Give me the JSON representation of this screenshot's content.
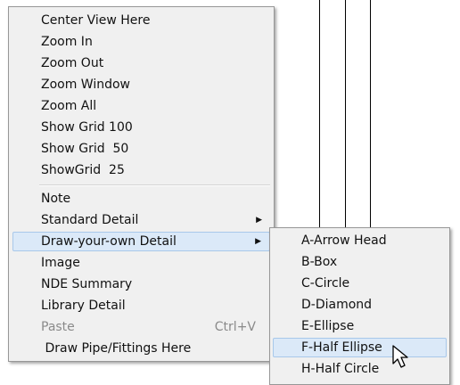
{
  "main_menu": {
    "items": [
      {
        "label": "Center View Here"
      },
      {
        "label": "Zoom In"
      },
      {
        "label": "Zoom Out"
      },
      {
        "label": "Zoom Window"
      },
      {
        "label": "Zoom All"
      },
      {
        "label": "Show Grid 100"
      },
      {
        "label": "Show Grid  50"
      },
      {
        "label": "ShowGrid  25"
      },
      {
        "label": "Note"
      },
      {
        "label": "Standard Detail"
      },
      {
        "label": "Draw-your-own Detail"
      },
      {
        "label": "Image"
      },
      {
        "label": "NDE Summary"
      },
      {
        "label": "Library Detail"
      },
      {
        "label": "Paste",
        "shortcut": "Ctrl+V"
      },
      {
        "label": " Draw Pipe/Fittings Here"
      }
    ]
  },
  "sub_menu": {
    "items": [
      {
        "label": "A-Arrow Head"
      },
      {
        "label": "B-Box"
      },
      {
        "label": "C-Circle"
      },
      {
        "label": "D-Diamond"
      },
      {
        "label": "E-Ellipse"
      },
      {
        "label": "F-Half Ellipse"
      },
      {
        "label": "H-Half Circle"
      }
    ]
  },
  "colors": {
    "menu_bg": "#f0f0f0",
    "highlight": "#dbe9f8",
    "disabled_text": "#8a8a8a"
  }
}
